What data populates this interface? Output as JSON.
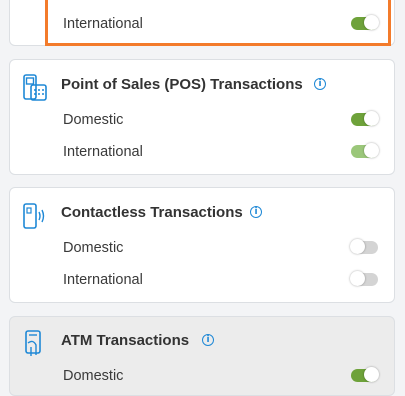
{
  "international_card": {
    "rows": [
      {
        "label": "International",
        "enabled": true
      }
    ]
  },
  "pos_card": {
    "title": "Point of Sales (POS) Transactions",
    "icon": "pos-terminal-icon",
    "rows": [
      {
        "label": "Domestic",
        "enabled": true
      },
      {
        "label": "International",
        "enabled": true
      }
    ]
  },
  "contactless_card": {
    "title": "Contactless Transactions",
    "icon": "contactless-card-icon",
    "rows": [
      {
        "label": "Domestic",
        "enabled": false
      },
      {
        "label": "International",
        "enabled": false
      }
    ]
  },
  "atm_card": {
    "title": "ATM Transactions",
    "icon": "atm-icon",
    "rows": [
      {
        "label": "Domestic",
        "enabled": true
      }
    ]
  },
  "colors": {
    "accent_blue": "#1e88d6",
    "toggle_on": "#6ea23a",
    "toggle_off": "#d4d4d4",
    "highlight": "#f37b2b"
  }
}
